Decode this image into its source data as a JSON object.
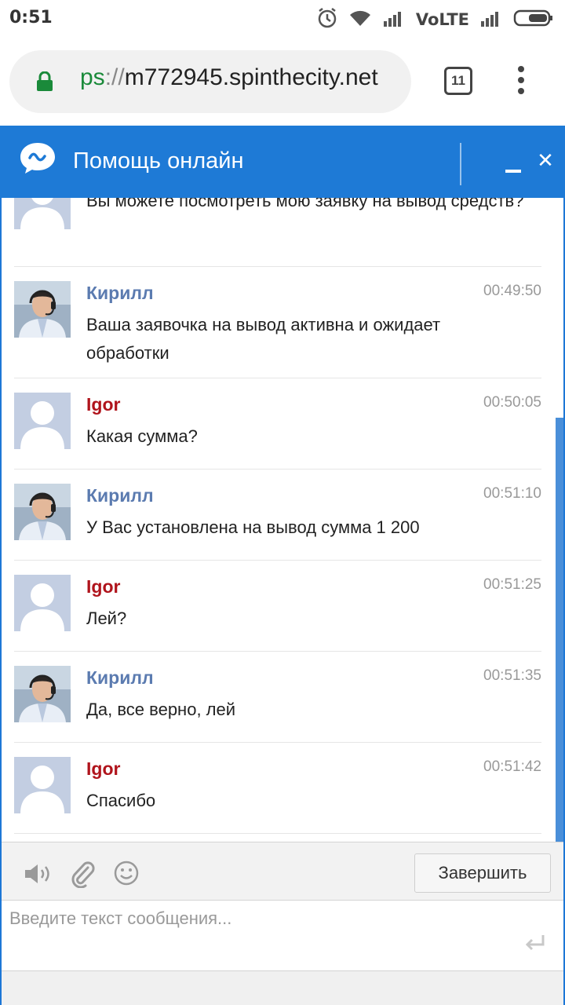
{
  "status_bar": {
    "time": "0:51",
    "network": "VoLTE",
    "icons": [
      "alarm-icon",
      "wifi-icon",
      "signal-icon",
      "signal-icon",
      "battery-icon"
    ]
  },
  "browser": {
    "url_scheme": "ps",
    "url_sep": "://",
    "url_host": "m772945.spinthecity.net",
    "tab_count": "11"
  },
  "chat": {
    "title": "Помощь онлайн",
    "colors": {
      "header": "#1e7ad6",
      "agent_name": "#5b7bb0",
      "user_name": "#b0141c"
    },
    "first_message_text": "Вы можете посмотреть мою заявку на вывод средств?",
    "messages": [
      {
        "name": "Кирилл",
        "role": "agent",
        "time": "00:49:50",
        "text": "Ваша заявочка на вывод активна и ожидает обработки"
      },
      {
        "name": "Igor",
        "role": "user",
        "time": "00:50:05",
        "text": "Какая сумма?"
      },
      {
        "name": "Кирилл",
        "role": "agent",
        "time": "00:51:10",
        "text": "У Вас установлена на вывод сумма 1 200"
      },
      {
        "name": "Igor",
        "role": "user",
        "time": "00:51:25",
        "text": "Лей?"
      },
      {
        "name": "Кирилл",
        "role": "agent",
        "time": "00:51:35",
        "text": "Да, все верно, лей"
      },
      {
        "name": "Igor",
        "role": "user",
        "time": "00:51:42",
        "text": "Спасибо"
      }
    ],
    "toolbar": {
      "icons": [
        "speaker-icon",
        "paperclip-icon",
        "smiley-icon"
      ],
      "end_label": "Завершить"
    },
    "input": {
      "placeholder": "Введите текст сообщения...",
      "value": ""
    }
  }
}
